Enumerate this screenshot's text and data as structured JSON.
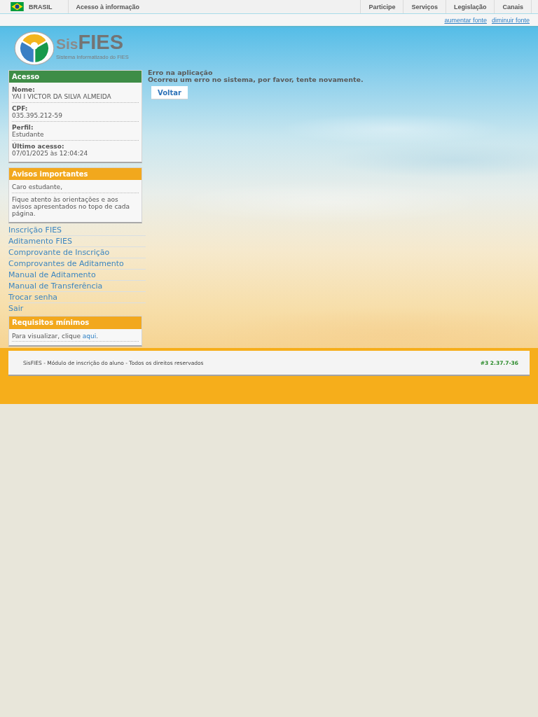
{
  "top_bar": {
    "country": "BRASIL",
    "left_links": [
      "Acesso à informação"
    ],
    "right_links": [
      "Participe",
      "Serviços",
      "Legislação",
      "Canais"
    ]
  },
  "font_links": [
    "aumentar fonte",
    "diminuir fonte"
  ],
  "logo": {
    "title_prefix": "Sis",
    "title_main": "FIES",
    "subtitle": "Sistema Informatizado do FIES"
  },
  "sidebar": {
    "access_panel": {
      "title": "Acesso",
      "fields": [
        {
          "label": "Nome:",
          "value": "YAI I VICTOR DA SILVA ALMEIDA"
        },
        {
          "label": "CPF:",
          "value": "035.395.212-59"
        },
        {
          "label": "Perfil:",
          "value": "Estudante"
        },
        {
          "label": "Último acesso:",
          "value": "07/01/2025 às 12:04:24"
        }
      ]
    },
    "notices_panel": {
      "title": "Avisos importantes",
      "paragraphs": [
        "Caro estudante,",
        "Fique atento às orientações e aos avisos apresentados no topo de cada página."
      ]
    },
    "menu": [
      "Inscrição FIES",
      "Aditamento FIES",
      "Comprovante de Inscrição",
      "Comprovantes de Aditamento",
      "Manual de Aditamento",
      "Manual de Transferência",
      "Trocar senha",
      "Sair"
    ],
    "requirements_panel": {
      "title": "Requisitos mínimos",
      "text_before": "Para visualizar, clique ",
      "link": "aqui",
      "text_after": "."
    }
  },
  "error": {
    "title": "Erro na aplicação",
    "message": "Ocorreu um erro no sistema, por favor, tente novamente.",
    "button": "Voltar"
  },
  "footer": {
    "text": "SisFIES - Módulo de inscrição do aluno - Todos os direitos reservados",
    "version": "#3 2.37.7-36"
  }
}
